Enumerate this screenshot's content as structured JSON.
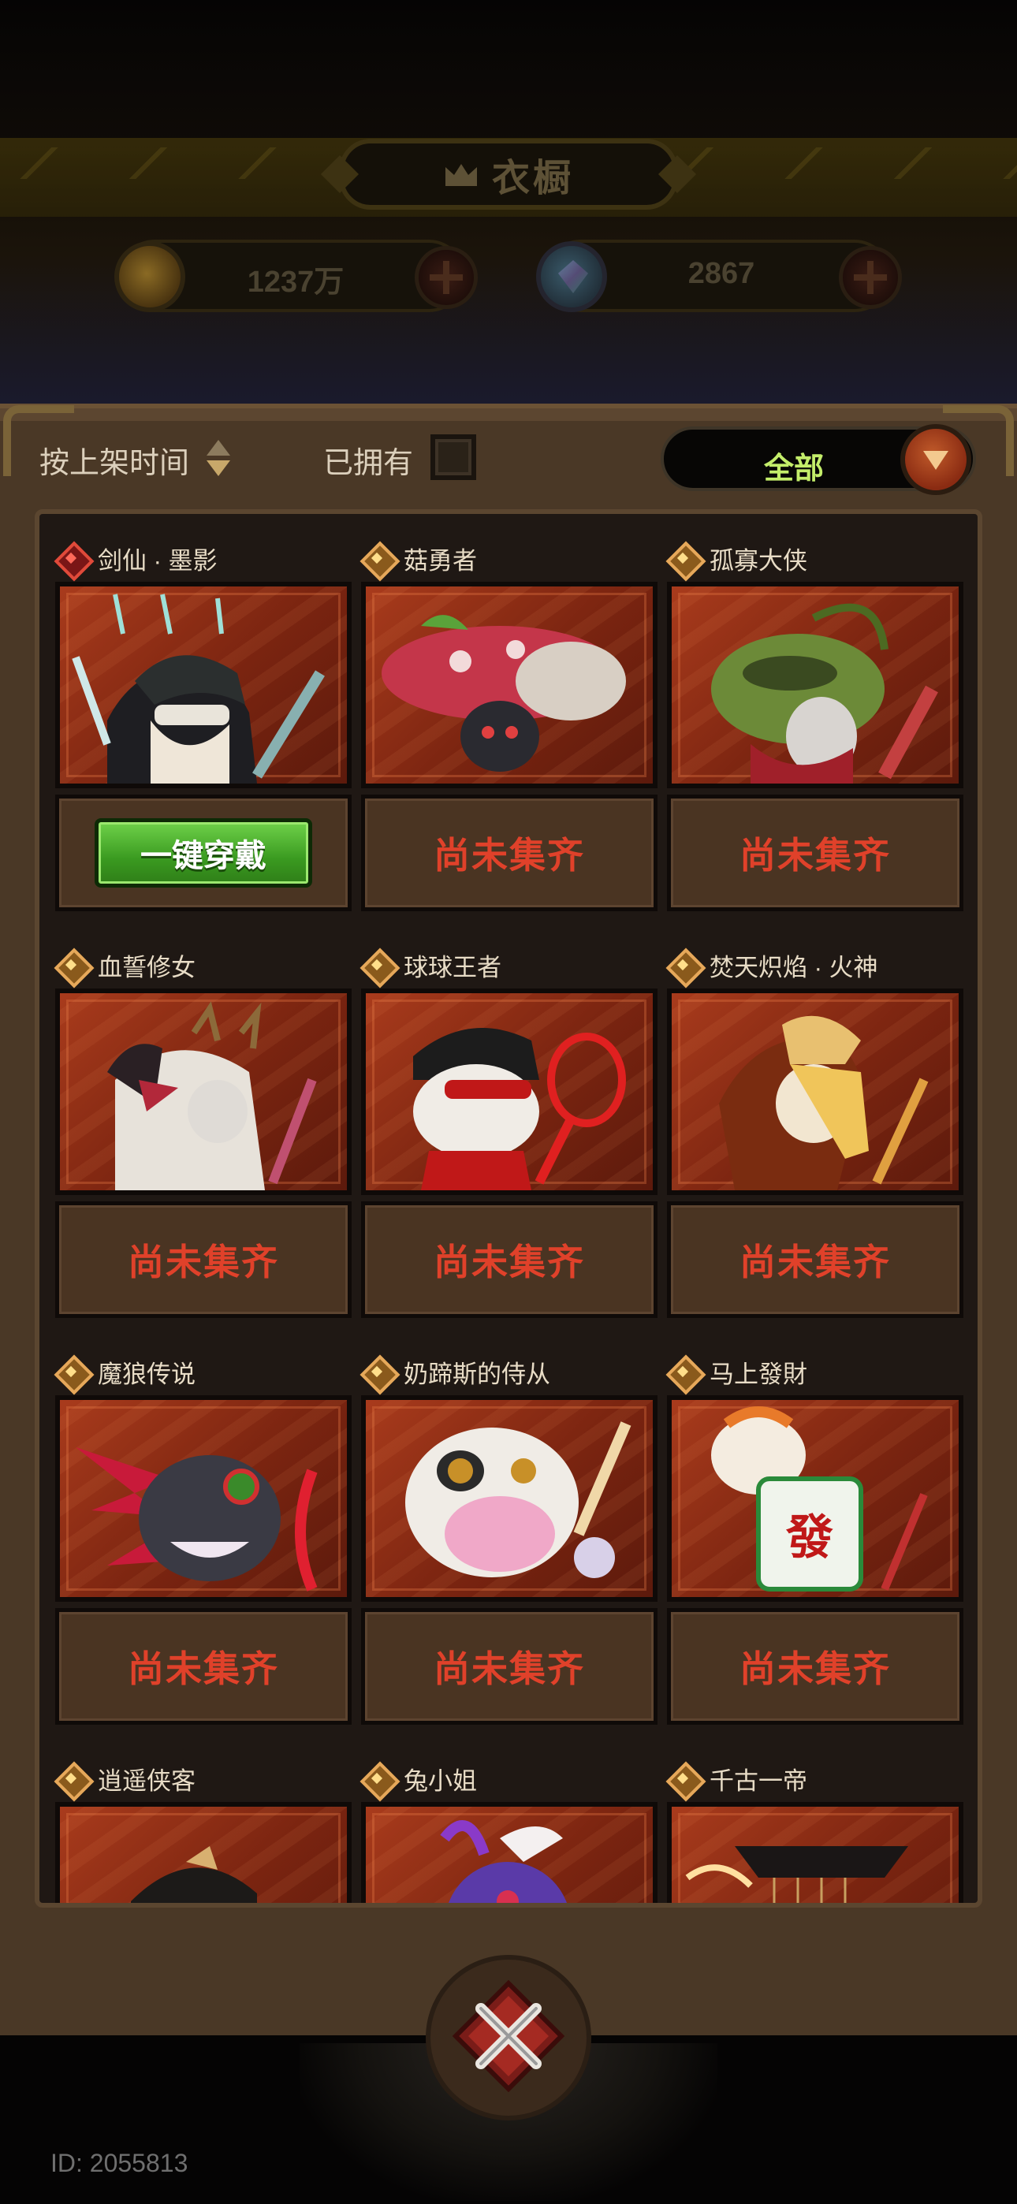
{
  "header": {
    "title": "衣橱",
    "title_icon": "crown-icon",
    "currencies": [
      {
        "name": "gold",
        "icon": "coin-icon",
        "value": "1237万"
      },
      {
        "name": "gem",
        "icon": "gem-icon",
        "value": "2867"
      }
    ]
  },
  "toolbar": {
    "sort_label": "按上架时间",
    "owned_label": "已拥有",
    "owned_checked": false,
    "filter_value": "全部"
  },
  "skins": [
    {
      "name": "剑仙 · 墨影",
      "rarity": "red",
      "status": "equip",
      "action_label": "一键穿戴"
    },
    {
      "name": "菇勇者",
      "rarity": "gold",
      "status": "incomplete",
      "action_label": "尚未集齐"
    },
    {
      "name": "孤寡大侠",
      "rarity": "gold",
      "status": "incomplete",
      "action_label": "尚未集齐"
    },
    {
      "name": "血誓修女",
      "rarity": "gold",
      "status": "incomplete",
      "action_label": "尚未集齐"
    },
    {
      "name": "球球王者",
      "rarity": "gold",
      "status": "incomplete",
      "action_label": "尚未集齐"
    },
    {
      "name": "焚天炽焰 · 火神",
      "rarity": "gold",
      "status": "incomplete",
      "action_label": "尚未集齐"
    },
    {
      "name": "魔狼传说",
      "rarity": "gold",
      "status": "incomplete",
      "action_label": "尚未集齐"
    },
    {
      "name": "奶蹄斯的侍从",
      "rarity": "gold",
      "status": "incomplete",
      "action_label": "尚未集齐"
    },
    {
      "name": "马上發財",
      "rarity": "gold",
      "status": "incomplete",
      "action_label": "尚未集齐"
    },
    {
      "name": "逍遥侠客",
      "rarity": "gold",
      "status": "partial",
      "action_label": ""
    },
    {
      "name": "兔小姐",
      "rarity": "gold",
      "status": "partial",
      "action_label": ""
    },
    {
      "name": "千古一帝",
      "rarity": "gold",
      "status": "partial",
      "action_label": ""
    }
  ],
  "colors": {
    "accent_green": "#c3ed6a",
    "status_red": "#e0412a",
    "equip_green": "#3a9a20"
  },
  "footer": {
    "close_icon": "close-x-icon",
    "id_text": "ID: 2055813"
  }
}
